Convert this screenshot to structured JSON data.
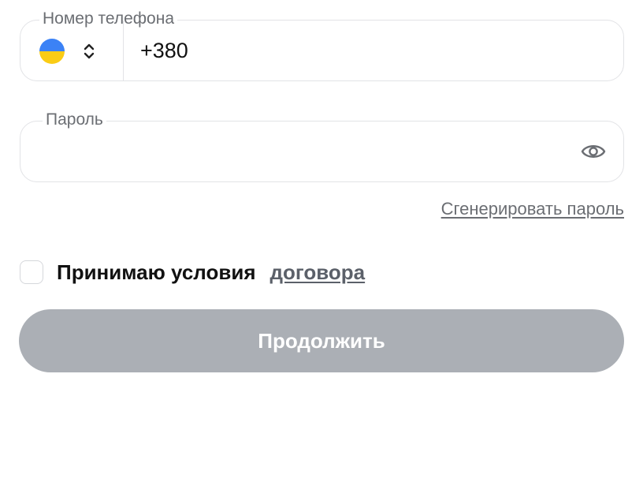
{
  "phone": {
    "legend": "Номер телефона",
    "country_flag": "ukraine-flag",
    "flag_colors": {
      "top": "#3b82f6",
      "bottom": "#facc15"
    },
    "value": "+380"
  },
  "password": {
    "legend": "Пароль",
    "value": "",
    "toggle_icon": "eye-icon"
  },
  "generate_password_link": "Сгенерировать пароль",
  "terms": {
    "checked": false,
    "label": "Принимаю условия",
    "link": "договора"
  },
  "continue_button": "Продолжить",
  "colors": {
    "border": "#e2e3e6",
    "muted_text": "#6b6e73",
    "link": "#5b6069",
    "button_disabled": "#abafb5"
  }
}
